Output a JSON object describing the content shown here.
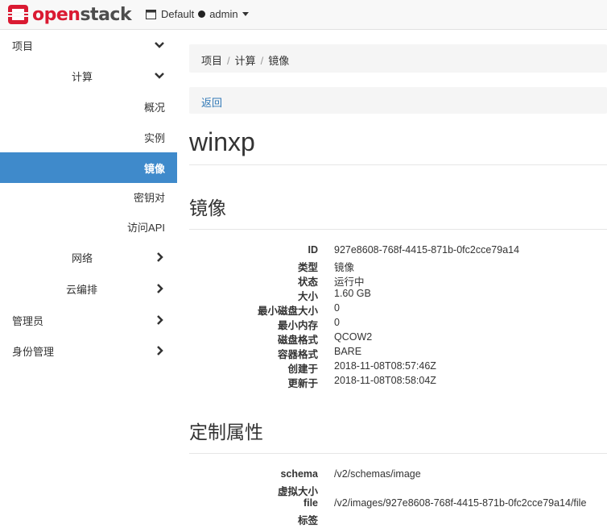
{
  "header": {
    "logo_red": "open",
    "logo_gray": "stack",
    "domain": "Default",
    "user": "admin"
  },
  "sidebar": {
    "project": "项目",
    "compute": "计算",
    "items": [
      "概况",
      "实例",
      "镜像",
      "密钥对",
      "访问API"
    ],
    "network": "网络",
    "orchestration": "云编排",
    "admin": "管理员",
    "identity": "身份管理"
  },
  "breadcrumb": [
    "项目",
    "计算",
    "镜像"
  ],
  "back_label": "返回",
  "page_title": "winxp",
  "image_section": {
    "title": "镜像",
    "rows": [
      {
        "k": "ID",
        "v": "927e8608-768f-4415-871b-0fc2cce79a14"
      },
      {
        "k": "类型",
        "v": "镜像"
      },
      {
        "k": "状态",
        "v": "运行中"
      },
      {
        "k": "大小",
        "v": "1.60 GB"
      },
      {
        "k": "最小磁盘大小",
        "v": "0"
      },
      {
        "k": "最小内存",
        "v": "0"
      },
      {
        "k": "磁盘格式",
        "v": "QCOW2"
      },
      {
        "k": "容器格式",
        "v": "BARE"
      },
      {
        "k": "创建于",
        "v": "2018-11-08T08:57:46Z"
      },
      {
        "k": "更新于",
        "v": "2018-11-08T08:58:04Z"
      }
    ]
  },
  "custom_section": {
    "title": "定制属性",
    "rows": [
      {
        "k": "schema",
        "v": "/v2/schemas/image"
      },
      {
        "k": "虚拟大小",
        "v": ""
      },
      {
        "k": "file",
        "v": "/v2/images/927e8608-768f-4415-871b-0fc2cce79a14/file"
      },
      {
        "k": "标签",
        "v": ""
      }
    ]
  }
}
